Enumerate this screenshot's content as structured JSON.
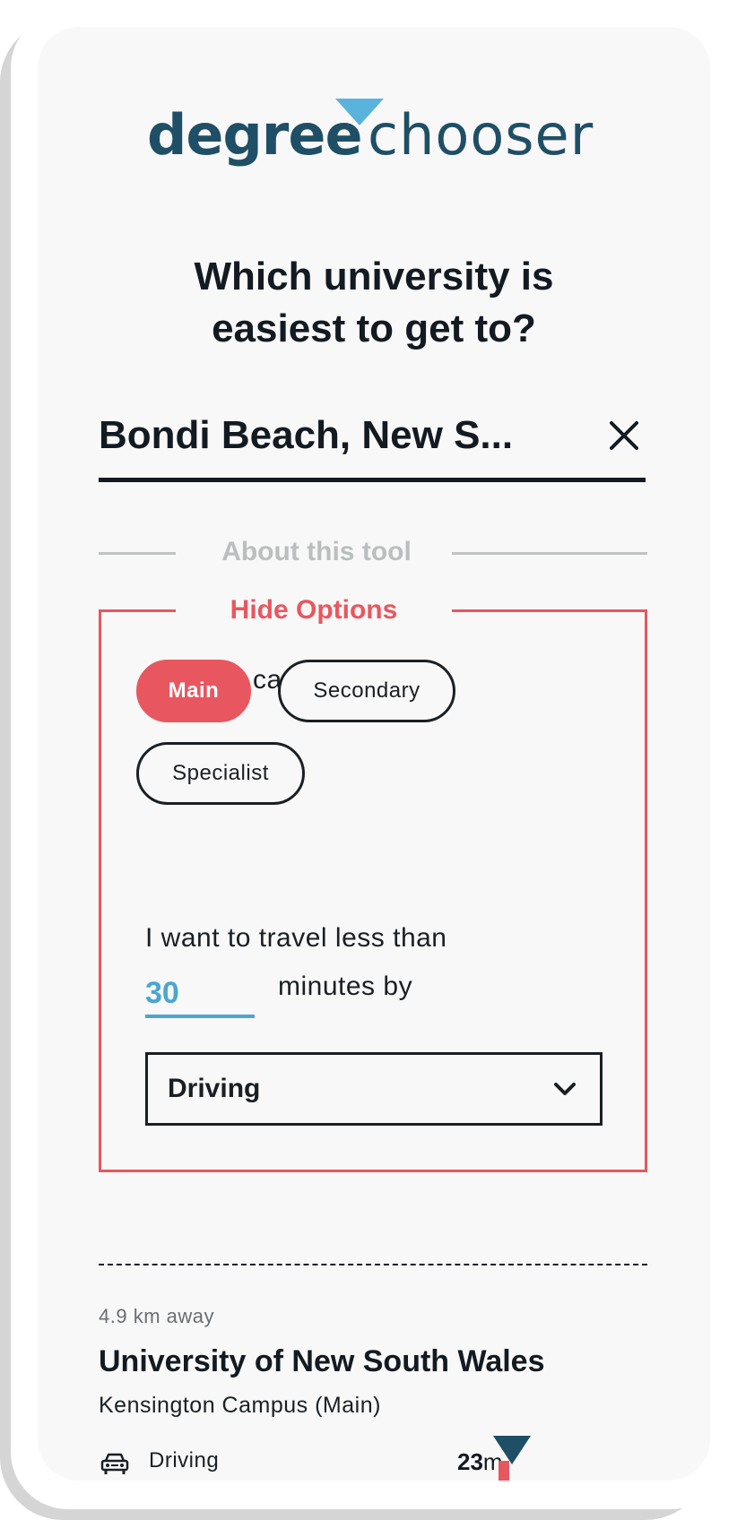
{
  "logo": {
    "word1": "degree",
    "word2": "chooser"
  },
  "title": {
    "line1": "Which university is",
    "line2": "easiest to get to?"
  },
  "location": {
    "value": "Bondi Beach, New S...",
    "clear_icon": "close-icon"
  },
  "about": {
    "label": "About this tool"
  },
  "options": {
    "toggle_label": "Hide Options",
    "filter_label": "Filter by campus type",
    "chips": [
      {
        "label": "Main",
        "active": true
      },
      {
        "label": "Secondary",
        "active": false
      },
      {
        "label": "Specialist",
        "active": false
      }
    ],
    "travel_label": "I want to travel less than",
    "minutes_value": "30",
    "minutes_suffix": "minutes by",
    "mode_selected": "Driving",
    "mode_icon": "chevron-down-icon"
  },
  "results": [
    {
      "distance": "4.9 km away",
      "name": "University of New South Wales",
      "campus": "Kensington Campus (Main)",
      "mode": "Driving",
      "mode_icon": "car-icon",
      "time_num": "23",
      "time_unit": "m",
      "time_fraction_of_limit": 0.77
    }
  ],
  "colors": {
    "brand_dark": "#1f4f66",
    "brand_light": "#5ab3dc",
    "accent_red": "#e8575f",
    "input_blue": "#4aa6d0"
  }
}
